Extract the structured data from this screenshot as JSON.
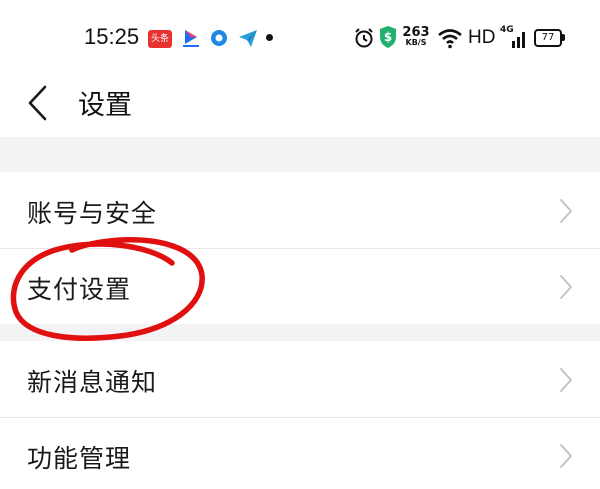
{
  "status_bar": {
    "time": "15:25",
    "notification_icons": [
      "toutiao-icon",
      "youku-icon",
      "circle-app-icon",
      "telegram-icon",
      "more-dot-icon"
    ],
    "toutiao_label": "头条",
    "network_speed": "263",
    "network_speed_unit": "KB/S",
    "hd_label": "HD",
    "network_type": "4G",
    "battery_level": "77"
  },
  "nav": {
    "back_icon": "chevron-left-icon",
    "title": "设置"
  },
  "settings": {
    "group1": [
      {
        "label": "账号与安全",
        "icon": "chevron-right-icon"
      },
      {
        "label": "支付设置",
        "icon": "chevron-right-icon"
      }
    ],
    "group2": [
      {
        "label": "新消息通知",
        "icon": "chevron-right-icon"
      },
      {
        "label": "功能管理",
        "icon": "chevron-right-icon"
      }
    ]
  },
  "annotation": {
    "color": "#e01010",
    "target": "支付设置"
  },
  "colors": {
    "background": "#f3f3f5",
    "surface": "#ffffff",
    "text": "#1a1a1a",
    "chevron": "#c4c4c8"
  }
}
